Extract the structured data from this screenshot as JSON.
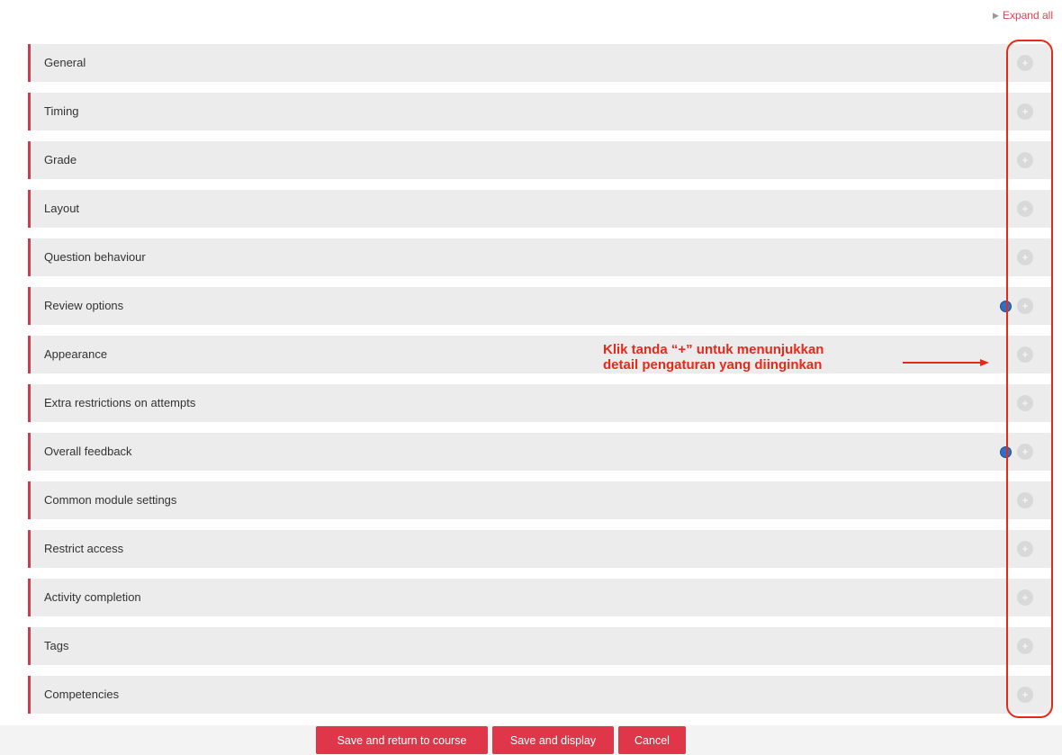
{
  "header": {
    "expand_all": "Expand all",
    "expand_icon": "triangle-right-icon"
  },
  "sections": [
    {
      "label": "General",
      "help": false
    },
    {
      "label": "Timing",
      "help": false
    },
    {
      "label": "Grade",
      "help": false
    },
    {
      "label": "Layout",
      "help": false
    },
    {
      "label": "Question behaviour",
      "help": false
    },
    {
      "label": "Review options",
      "help": true
    },
    {
      "label": "Appearance",
      "help": false
    },
    {
      "label": "Extra restrictions on attempts",
      "help": false
    },
    {
      "label": "Overall feedback",
      "help": true
    },
    {
      "label": "Common module settings",
      "help": false
    },
    {
      "label": "Restrict access",
      "help": false
    },
    {
      "label": "Activity completion",
      "help": false
    },
    {
      "label": "Tags",
      "help": false
    },
    {
      "label": "Competencies",
      "help": false
    }
  ],
  "expand_symbol": "+",
  "annotation": {
    "line1": "Klik tanda “+” untuk menunjukkan",
    "line2": "detail pengaturan yang diinginkan"
  },
  "buttons": {
    "save_return": "Save and return to course",
    "save_display": "Save and display",
    "cancel": "Cancel"
  },
  "colors": {
    "accent": "#e0364a",
    "section_bg": "#ececec",
    "annotation": "#e42a1a"
  }
}
